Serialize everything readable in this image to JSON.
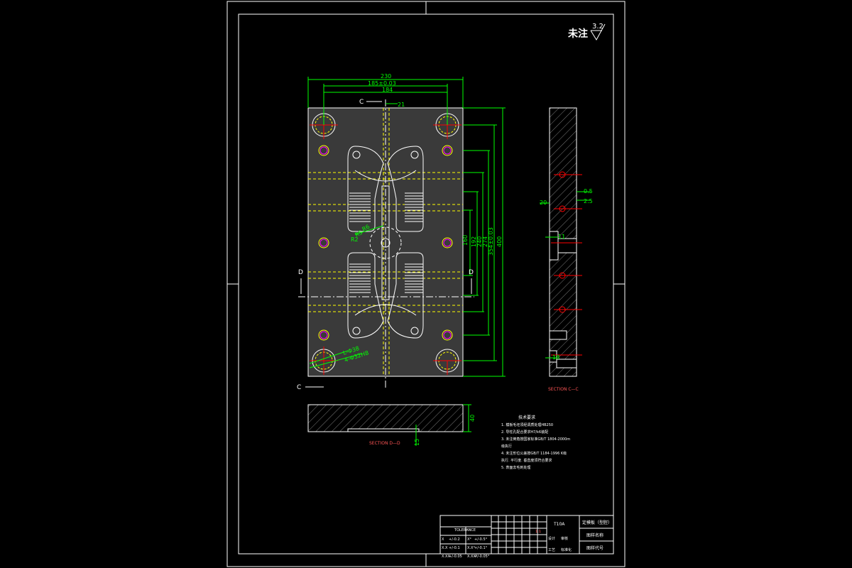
{
  "colors": {
    "background": "#000000",
    "border": "#ffffff",
    "dimension": "#00ff00",
    "hidden": "#ffff00",
    "center": "#ff0000",
    "hole_small": "#ff00ff",
    "hatch": "#8a8a8a"
  },
  "drawing": {
    "surface_note": "未注",
    "roughness_value": "3.2",
    "dims_top": {
      "overall": "230",
      "inner": "185±0.03",
      "center": "184",
      "offset": "21"
    },
    "dims_right": {
      "d1": "160",
      "d2": "192",
      "d3": "240",
      "d4": "274",
      "d5": "354±0.03",
      "d6": "400"
    },
    "dims_hole": {
      "dia1": "L-Φ38",
      "dia2": "4-Φ32H8",
      "r1": "R6",
      "r2": "R5",
      "r3": "R2"
    },
    "section_cc": {
      "label": "SECTION C—C",
      "d_left": "20",
      "d_right1": "0.5",
      "d_right2": "2.5",
      "mark1": "11",
      "mark2": "18"
    },
    "section_dd": {
      "label": "SECTION D—D",
      "thickness": "40",
      "depth": "15"
    },
    "cut_labels": {
      "c_top": "C",
      "c_bottom": "C",
      "d_left": "D",
      "d_right": "D"
    },
    "notes_title": "技术要求",
    "notes": [
      "1. 模板毛坯须经调质处理HB250",
      "2. 导柱孔配合要求H7/k6装配",
      "3. 未注倒角按国家标准GB/T 1804-2000m",
      "   级执行",
      "4. 未注形位公差按GB/T 1184-1996 K级",
      "   执行. 平行度. 垂直度须符合要求",
      "5. 表面去毛刺处理"
    ]
  },
  "title_block": {
    "tolerance_header": "TOLERANCE",
    "tolerance_rows": [
      [
        "X",
        "+/-0.2",
        "X°",
        "+/-0.5°"
      ],
      [
        "X.X",
        "+/-0.1",
        "X.X°",
        "+/-0.1°"
      ],
      [
        "X.XX",
        "+/-0.05",
        "X.XX°",
        "+/-0.05°"
      ]
    ],
    "material": "T10A",
    "part_name": "定模板（型腔）",
    "drawing_name_label": "图样名称",
    "drawing_code_label": "图样代号",
    "scale_label": "1:1",
    "sign_labels": [
      "设计",
      "审核",
      "工艺",
      "标准化"
    ]
  }
}
